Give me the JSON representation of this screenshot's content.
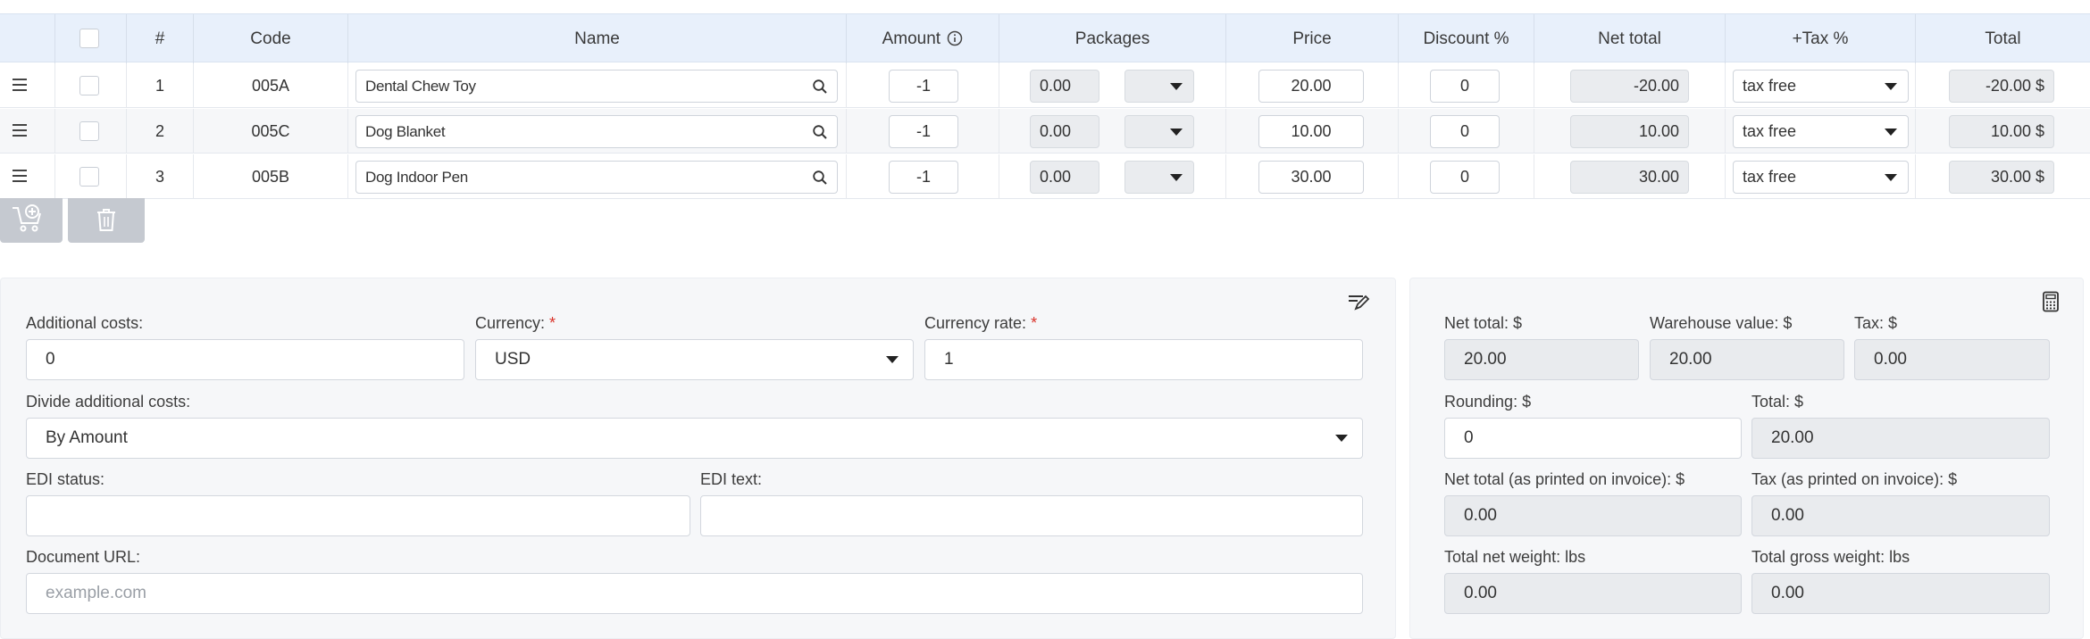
{
  "columns": {
    "num": "#",
    "code": "Code",
    "name": "Name",
    "amount": "Amount",
    "packages": "Packages",
    "price": "Price",
    "discount": "Discount %",
    "net_total": "Net total",
    "tax": "+Tax %",
    "total": "Total"
  },
  "rows": [
    {
      "num": "1",
      "code": "005A",
      "name": "Dental Chew Toy",
      "amount": "-1",
      "packages": "0.00",
      "price": "20.00",
      "discount": "0",
      "net_total": "-20.00",
      "tax": "tax free",
      "total": "-20.00 $"
    },
    {
      "num": "2",
      "code": "005C",
      "name": "Dog Blanket",
      "amount": "-1",
      "packages": "0.00",
      "price": "10.00",
      "discount": "0",
      "net_total": "10.00",
      "tax": "tax free",
      "total": "10.00 $"
    },
    {
      "num": "3",
      "code": "005B",
      "name": "Dog Indoor Pen",
      "amount": "-1",
      "packages": "0.00",
      "price": "30.00",
      "discount": "0",
      "net_total": "30.00",
      "tax": "tax free",
      "total": "30.00 $"
    }
  ],
  "form": {
    "additional_costs_label": "Additional costs:",
    "additional_costs_value": "0",
    "currency_label": "Currency:",
    "currency_value": "USD",
    "currency_rate_label": "Currency rate:",
    "currency_rate_value": "1",
    "required_mark": "*",
    "divide_label": "Divide additional costs:",
    "divide_value": "By Amount",
    "edi_status_label": "EDI status:",
    "edi_status_value": "",
    "edi_text_label": "EDI text:",
    "edi_text_value": "",
    "doc_url_label": "Document URL:",
    "doc_url_placeholder": "example.com"
  },
  "totals": {
    "net_total_label": "Net total: $",
    "net_total_value": "20.00",
    "warehouse_label": "Warehouse value: $",
    "warehouse_value": "20.00",
    "tax_label": "Tax: $",
    "tax_value": "0.00",
    "rounding_label": "Rounding: $",
    "rounding_value": "0",
    "total_label": "Total: $",
    "total_value": "20.00",
    "net_printed_label": "Net total (as printed on invoice): $",
    "net_printed_value": "0.00",
    "tax_printed_label": "Tax (as printed on invoice): $",
    "tax_printed_value": "0.00",
    "net_weight_label": "Total net weight: lbs",
    "net_weight_value": "0.00",
    "gross_weight_label": "Total gross weight: lbs",
    "gross_weight_value": "0.00"
  },
  "icons": {
    "drag": "drag-handle-icon",
    "search": "search-icon",
    "info": "info-icon",
    "add_to_cart": "add-to-cart-icon",
    "trash": "trash-icon",
    "edit": "edit-icon",
    "calculator": "calculator-icon"
  },
  "colors": {
    "header_bg": "#e8f0fb",
    "readonly_bg": "#eaecef",
    "required": "#d9342b",
    "button_bg": "#c5c9d0"
  }
}
